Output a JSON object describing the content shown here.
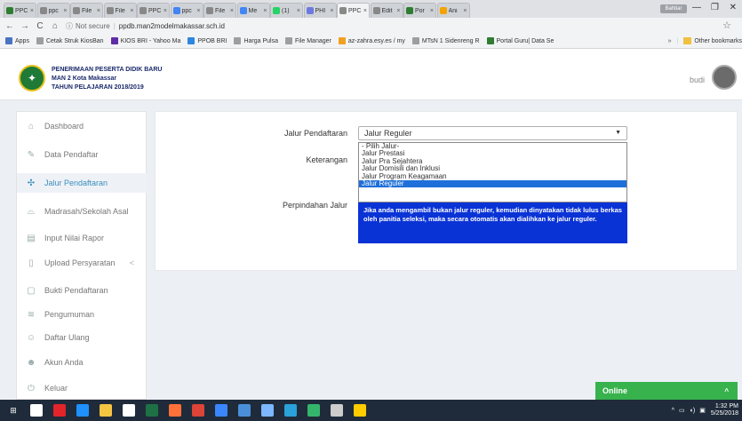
{
  "browser": {
    "tabs": [
      {
        "label": "PPC",
        "icon": "ppdb-icon",
        "color": "#2e7d32"
      },
      {
        "label": "ppc",
        "icon": "page-icon",
        "color": "#888888"
      },
      {
        "label": "File",
        "icon": "page-icon",
        "color": "#888888"
      },
      {
        "label": "File",
        "icon": "page-icon",
        "color": "#888888"
      },
      {
        "label": "PPC",
        "icon": "page-icon",
        "color": "#888888"
      },
      {
        "label": "ppc",
        "icon": "google-icon",
        "color": "#4285f4"
      },
      {
        "label": "File",
        "icon": "page-icon",
        "color": "#888888"
      },
      {
        "label": "Me",
        "icon": "google-icon",
        "color": "#4285f4"
      },
      {
        "label": "(1)",
        "icon": "whatsapp-icon",
        "color": "#25d366"
      },
      {
        "label": "PHI",
        "icon": "pma-icon",
        "color": "#6c7ae0"
      },
      {
        "label": "PPC",
        "icon": "page-icon",
        "color": "#888888",
        "active": true
      },
      {
        "label": "Edit",
        "icon": "page-icon",
        "color": "#888888"
      },
      {
        "label": "Por",
        "icon": "ppdb-icon",
        "color": "#2e7d32"
      },
      {
        "label": "Ani",
        "icon": "chart-icon",
        "color": "#f4a300"
      }
    ],
    "profile_chip": "Bahtiar",
    "minimize": "—",
    "maximize": "❐",
    "close": "✕",
    "url_secure_text": "Not secure",
    "url": "ppdb.man2modelmakassar.sch.id",
    "bookmarks": [
      {
        "label": "Apps",
        "color": "#4a73c4"
      },
      {
        "label": "Cetak Struk KiosBan",
        "color": "#9e9e9e"
      },
      {
        "label": "KIOS BRI - Yahoo Ma",
        "color": "#5e2ca5"
      },
      {
        "label": "PPOB BRI",
        "color": "#2e86de"
      },
      {
        "label": "Harga Pulsa",
        "color": "#9e9e9e"
      },
      {
        "label": "File Manager",
        "color": "#9e9e9e"
      },
      {
        "label": "az-zahra.esy.es / my",
        "color": "#f0a020"
      },
      {
        "label": "MTsN 1 Sidenreng R",
        "color": "#9e9e9e"
      },
      {
        "label": "Portal Guru| Data Se",
        "color": "#2e7d32"
      }
    ],
    "more_bookmarks": "»",
    "other_bookmarks": "Other bookmarks"
  },
  "header": {
    "line1": "PENERIMAAN PESERTA DIDIK BARU",
    "line2": "MAN 2 Kota Makassar",
    "line3": "TAHUN PELAJARAN 2018/2019",
    "user_name": "budi"
  },
  "sidebar": {
    "items": [
      {
        "label": "Dashboard",
        "icon": "home-icon",
        "glyph": "⌂"
      },
      {
        "label": "Data Pendaftar",
        "icon": "edit-icon",
        "glyph": "✎"
      },
      {
        "label": "Jalur Pendaftaran",
        "icon": "arrows-icon",
        "glyph": "✣",
        "active": true
      },
      {
        "label": "Madrasah/Sekolah Asal",
        "icon": "graduation-icon",
        "glyph": "⌓"
      },
      {
        "label": "Input Nilai Rapor",
        "icon": "book-icon",
        "glyph": "▤"
      },
      {
        "label": "Upload Persyaratan",
        "icon": "file-icon",
        "glyph": "▯",
        "chevron": "<"
      },
      {
        "label": "Bukti Pendaftaran",
        "icon": "square-icon",
        "glyph": "▢"
      },
      {
        "label": "Pengumuman",
        "icon": "announce-icon",
        "glyph": "≋"
      },
      {
        "label": "Daftar Ulang",
        "icon": "users-icon",
        "glyph": "☺"
      },
      {
        "label": "Akun Anda",
        "icon": "user-icon",
        "glyph": "☻"
      },
      {
        "label": "Keluar",
        "icon": "power-icon",
        "glyph": "⏻"
      }
    ]
  },
  "form": {
    "jalur_label": "Jalur Pendaftaran",
    "keterangan_label": "Keterangan",
    "perpindahan_label": "Perpindahan Jalur",
    "select_value": "Jalur Reguler",
    "options": [
      "- Pilih Jalur-",
      "Jalur Prestasi",
      "Jalur Pra Sejahtera",
      "Jalur Domisili dan Inklusi",
      "Jalur Program Keagamaan",
      "Jalur Reguler"
    ],
    "selected_index": 5,
    "notice": "Jika anda mengambil bukan jalur reguler, kemudian dinyatakan tidak lulus berkas oleh panitia seleksi, maka secara otomatis akan dialihkan ke jalur reguler."
  },
  "chat": {
    "label": "Online",
    "toggle": "^"
  },
  "taskbar": {
    "apps": [
      {
        "icon": "windows-icon",
        "color": "#ffffff"
      },
      {
        "icon": "task-view-icon",
        "color": "#ffffff"
      },
      {
        "icon": "opera-icon",
        "color": "#e3242b"
      },
      {
        "icon": "edge-icon",
        "color": "#1e90ff"
      },
      {
        "icon": "explorer-icon",
        "color": "#f4c542"
      },
      {
        "icon": "store-icon",
        "color": "#ffffff"
      },
      {
        "icon": "excel-icon",
        "color": "#1e7145"
      },
      {
        "icon": "firefox-icon",
        "color": "#ff7139"
      },
      {
        "icon": "chrome-icon",
        "color": "#db4437"
      },
      {
        "icon": "mail-icon",
        "color": "#3a86ff"
      },
      {
        "icon": "winamp-icon",
        "color": "#4a90d9"
      },
      {
        "icon": "photos-icon",
        "color": "#7cb7ff"
      },
      {
        "icon": "telegram-icon",
        "color": "#2aa1d9"
      },
      {
        "icon": "app-icon",
        "color": "#35b56c"
      },
      {
        "icon": "app2-icon",
        "color": "#cccccc"
      },
      {
        "icon": "app3-icon",
        "color": "#ffcc00"
      }
    ],
    "time": "1:32 PM",
    "date": "5/25/2018"
  }
}
